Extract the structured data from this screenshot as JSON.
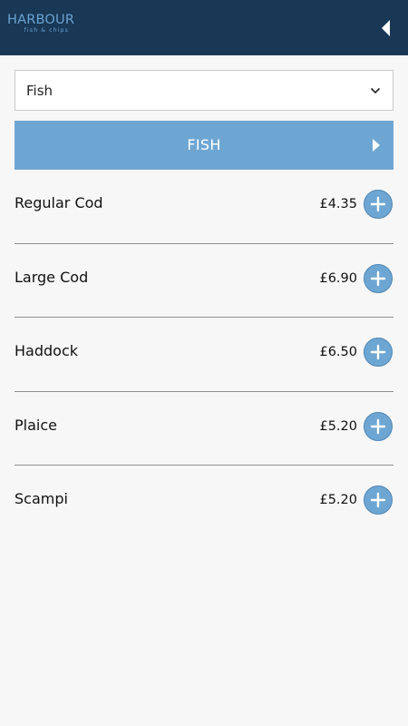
{
  "header": {
    "logo_main": "HARBOUR",
    "logo_sub": "fish & chips",
    "back_icon": "back-arrow-icon"
  },
  "category_select": {
    "value": "Fish",
    "icon": "chevron-down-icon"
  },
  "section": {
    "title": "FISH",
    "icon": "chevron-right-icon"
  },
  "menu": {
    "items": [
      {
        "name": "Regular Cod",
        "price": "£4.35"
      },
      {
        "name": "Large Cod",
        "price": "£6.90"
      },
      {
        "name": "Haddock",
        "price": "£6.50"
      },
      {
        "name": "Plaice",
        "price": "£5.20"
      },
      {
        "name": "Scampi",
        "price": "£5.20"
      }
    ],
    "add_icon": "plus-icon"
  },
  "colors": {
    "header_bg": "#193855",
    "accent": "#6ea6d3",
    "background": "#f7f7f7"
  }
}
